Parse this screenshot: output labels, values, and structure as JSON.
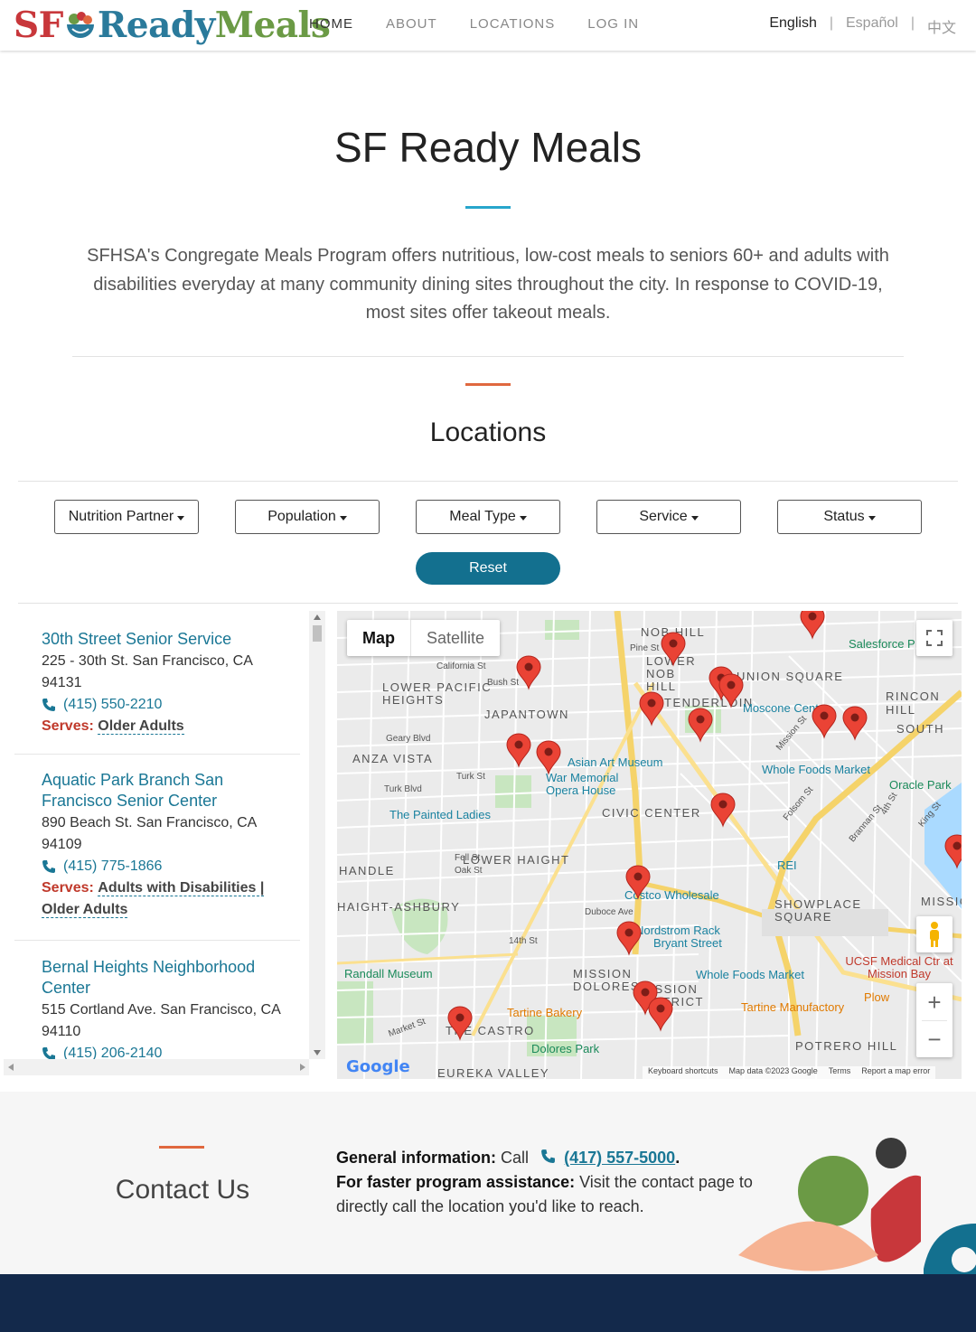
{
  "nav": {
    "brand": {
      "sf": "SF",
      "ready": "Ready",
      "meals": "Meals"
    },
    "items": [
      {
        "label": "HOME",
        "active": true
      },
      {
        "label": "ABOUT"
      },
      {
        "label": "LOCATIONS"
      },
      {
        "label": "LOG IN"
      }
    ],
    "languages": [
      "English",
      "Español",
      "中文"
    ],
    "separator": "|"
  },
  "hero": {
    "title": "SF Ready Meals",
    "intro": "SFHSA's Congregate Meals Program offers nutritious, low-cost meals to seniors 60+ and adults with disabilities everyday at many community dining sites throughout the city. In response to COVID-19, most sites offer takeout meals."
  },
  "locations": {
    "title": "Locations",
    "filters": [
      "Nutrition Partner",
      "Population",
      "Meal Type",
      "Service",
      "Status"
    ],
    "reset_label": "Reset",
    "serves_label": "Serves:",
    "list": [
      {
        "name": "30th Street Senior Service",
        "address": "225 - 30th St. San Francisco, CA 94131",
        "phone": "(415) 550-2210",
        "serves": "Older Adults"
      },
      {
        "name": "Aquatic Park Branch San Francisco Senior Center",
        "address": "890 Beach St. San Francisco, CA 94109",
        "phone": "(415) 775-1866",
        "serves": "Adults with Disabilities | Older Adults"
      },
      {
        "name": "Bernal Heights Neighborhood Center",
        "address": "515 Cortland Ave. San Francisco, CA 94110",
        "phone": "(415) 206-2140",
        "serves": ""
      }
    ]
  },
  "map": {
    "type_options": [
      "Map",
      "Satellite"
    ],
    "selected_type": "Map",
    "zoom_in": "+",
    "zoom_out": "−",
    "attribution": {
      "google": "Google",
      "shortcuts": "Keyboard shortcuts",
      "data": "Map data ©2023 Google",
      "terms": "Terms",
      "report": "Report a map error"
    },
    "labels": [
      "NOB HILL",
      "LOWER NOB HILL",
      "UNION SQUARE",
      "LOWER PACIFIC HEIGHTS",
      "JAPANTOWN",
      "TENDERLOIN",
      "RINCON HILL",
      "SOUTH",
      "Salesforce P",
      "Moscone Center",
      "ANZA VISTA",
      "Asian Art Museum",
      "War Memorial Opera House",
      "Whole Foods Market",
      "Oracle Park",
      "The Painted Ladies",
      "CIVIC CENTER",
      "LOWER HAIGHT",
      "REI",
      "Costco Wholesale",
      "HANDLE",
      "SHOWPLACE SQUARE",
      "MISSION",
      "HAIGHT-ASHBURY",
      "Duboce Ave",
      "Nordstrom Rack",
      "Bryant Street",
      "Whole Foods Market",
      "UCSF Medical Ctr at Mission Bay",
      "Randall Museum",
      "MISSION DOLORES",
      "MISSION DISTRICT",
      "Tartine Bakery",
      "Tartine Manufactory",
      "Plow",
      "THE CASTRO",
      "Dolores Park",
      "POTRERO HILL",
      "EUREKA VALLEY",
      "Market St",
      "14th St",
      "Pine St",
      "Bush St",
      "California St",
      "Geary Blvd",
      "Turk Blvd",
      "Turk St",
      "Fell St",
      "Oak St",
      "Folsom St",
      "Mission St",
      "Brannan St",
      "King St",
      "4th St"
    ]
  },
  "contact": {
    "title": "Contact Us",
    "general_label": "General information:",
    "general_text": "Call",
    "general_phone": "(417) 557-5000",
    "faster_label": "For faster program assistance:",
    "faster_text": "Visit the contact page to directly call the location you'd like to reach."
  },
  "colors": {
    "brand_red": "#c8373b",
    "brand_blue": "#2a7a9b",
    "brand_green": "#6b9a45",
    "link": "#1a7795",
    "reset": "#13708f",
    "footer": "#13294b",
    "accent_bar_blue": "#28a6cc",
    "accent_bar_orange": "#e0683f"
  }
}
